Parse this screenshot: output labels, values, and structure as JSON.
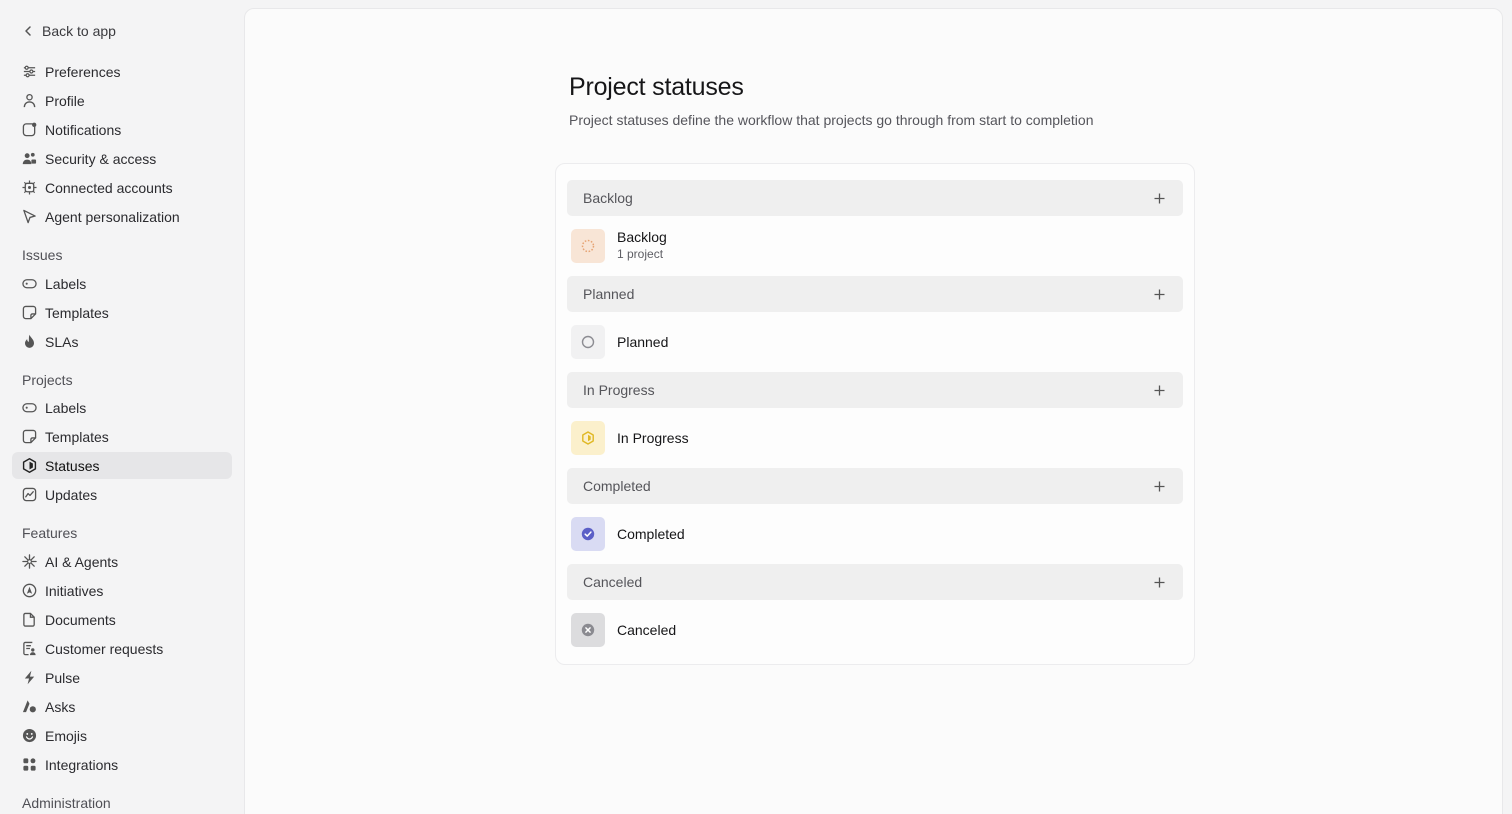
{
  "sidebar": {
    "back_label": "Back to app",
    "top_items": [
      {
        "label": "Preferences",
        "icon": "sliders-icon"
      },
      {
        "label": "Profile",
        "icon": "person-icon"
      },
      {
        "label": "Notifications",
        "icon": "notification-icon"
      },
      {
        "label": "Security & access",
        "icon": "users-lock-icon"
      },
      {
        "label": "Connected accounts",
        "icon": "plug-icon"
      },
      {
        "label": "Agent personalization",
        "icon": "cursor-icon"
      }
    ],
    "sections": [
      {
        "title": "Issues",
        "items": [
          {
            "label": "Labels",
            "icon": "label-icon"
          },
          {
            "label": "Templates",
            "icon": "template-icon"
          },
          {
            "label": "SLAs",
            "icon": "flame-icon"
          }
        ]
      },
      {
        "title": "Projects",
        "items": [
          {
            "label": "Labels",
            "icon": "label-icon"
          },
          {
            "label": "Templates",
            "icon": "template-icon"
          },
          {
            "label": "Statuses",
            "icon": "hexagon-icon",
            "active": true
          },
          {
            "label": "Updates",
            "icon": "pulse-chart-icon"
          }
        ]
      },
      {
        "title": "Features",
        "items": [
          {
            "label": "AI & Agents",
            "icon": "sparkle-icon"
          },
          {
            "label": "Initiatives",
            "icon": "compass-icon"
          },
          {
            "label": "Documents",
            "icon": "document-icon"
          },
          {
            "label": "Customer requests",
            "icon": "request-icon"
          },
          {
            "label": "Pulse",
            "icon": "bolt-icon"
          },
          {
            "label": "Asks",
            "icon": "asks-icon"
          },
          {
            "label": "Emojis",
            "icon": "smiley-icon"
          },
          {
            "label": "Integrations",
            "icon": "grid-icon"
          }
        ]
      },
      {
        "title": "Administration",
        "items": []
      }
    ]
  },
  "page": {
    "title": "Project statuses",
    "subtitle": "Project statuses define the workflow that projects go through from start to completion"
  },
  "groups": [
    {
      "header": "Backlog",
      "status": "Backlog",
      "count": "1 project",
      "icon": "dashed-circle-icon",
      "icon_color": "#e6a474",
      "bg": "#f8e5d6"
    },
    {
      "header": "Planned",
      "status": "Planned",
      "count": "",
      "icon": "empty-circle-icon",
      "icon_color": "#8c8c92",
      "bg": "#f1f1f2"
    },
    {
      "header": "In Progress",
      "status": "In Progress",
      "count": "",
      "icon": "half-hexagon-icon",
      "icon_color": "#e0b824",
      "bg": "#fbf0cc"
    },
    {
      "header": "Completed",
      "status": "Completed",
      "count": "",
      "icon": "check-circle-icon",
      "icon_color": "#5b5fc7",
      "bg": "#d9dbf3"
    },
    {
      "header": "Canceled",
      "status": "Canceled",
      "count": "",
      "icon": "x-circle-icon",
      "icon_color": "#8a8a90",
      "bg": "#dcdcde"
    }
  ]
}
